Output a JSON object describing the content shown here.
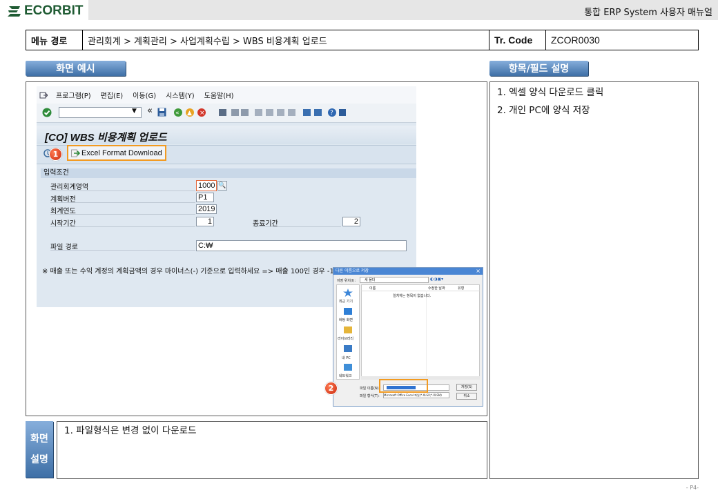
{
  "header": {
    "logo": "ECORBIT",
    "title": "통합 ERP System 사용자 매뉴얼"
  },
  "path": {
    "label": "메뉴 경로",
    "value": "관리회계 > 계획관리 > 사업계획수립 > WBS 비용계획 업로드",
    "tr_label": "Tr. Code",
    "tr_value": "ZCOR0030"
  },
  "sections": {
    "screen_example": "화면 예시",
    "field_desc": "항목/필드 설명",
    "screen_desc_1": "화면",
    "screen_desc_2": "설명"
  },
  "field_desc_items": [
    "1.  엑셀 양식 다운로드 클릭",
    "2.  개인 PC에 양식 저장"
  ],
  "screen_desc_items": [
    "1.  파일형식은 변경 없이 다운로드"
  ],
  "sap": {
    "menu": [
      "프로그램(P)",
      "편집(E)",
      "이동(G)",
      "시스템(Y)",
      "도움말(H)"
    ],
    "title": "[CO] WBS 비용계획 업로드",
    "excel_button": "Excel Format Download",
    "group_header": "입력조건",
    "fields": {
      "area_label": "관리회계영역",
      "area_value": "1000",
      "version_label": "계획버전",
      "version_value": "P1",
      "year_label": "회계연도",
      "year_value": "2019",
      "start_label": "시작기간",
      "start_value": "1",
      "end_label": "종료기간",
      "end_value": "2",
      "file_label": "파일 경로",
      "file_value": "C:₩"
    },
    "note": "※ 매출 또는 수익 계정의 계획금액의 경우 마이너스(-) 기준으로 입력하세요 => 매출 100인 경우 -100 입력"
  },
  "dialog": {
    "title": "다른 이름으로 저장",
    "save_in_label": "저장 위치(I):",
    "save_in_value": "새 폴더",
    "col_name": "이름",
    "col_date": "수정한 날짜",
    "col_type": "유형",
    "empty": "일치하는 항목이 없습니다.",
    "places": [
      "최근 기기",
      "바탕 화면",
      "라이브러리",
      "내 PC",
      "네트워크"
    ],
    "filename_label": "파일 이름(N):",
    "filetype_label": "파일 형식(T):",
    "filetype_value": "Microsoft Office Excel 파일(*.XLSX;*.XLSM)",
    "save_button": "저장(S)",
    "cancel_button": "취소"
  },
  "markers": [
    "1",
    "2"
  ],
  "page_number": "- P4-"
}
